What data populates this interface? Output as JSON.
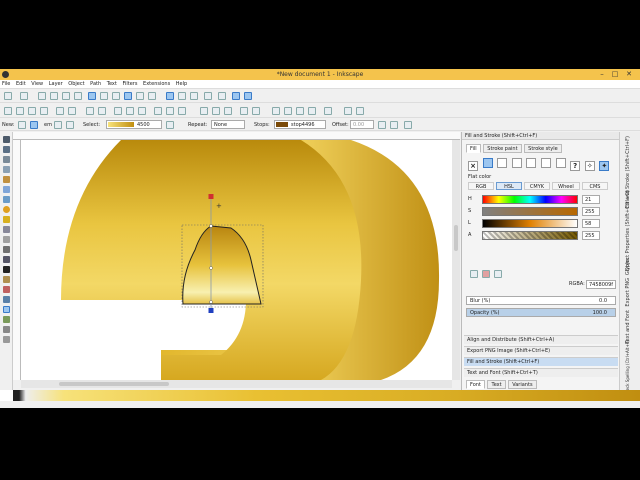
{
  "window": {
    "title": "*New document 1 - Inkscape",
    "min_label": "–",
    "max_label": "□",
    "close_label": "✕"
  },
  "menu": [
    "File",
    "Edit",
    "View",
    "Layer",
    "Object",
    "Path",
    "Text",
    "Filters",
    "Extensions",
    "Help"
  ],
  "gradient_toolbar": {
    "new_label": "New:",
    "units": "em",
    "select_label": "Select:",
    "select_value": "4500",
    "repeat_label": "Repeat:",
    "repeat_value": "None",
    "stops_label": "Stops:",
    "stop_value": "stop4496",
    "offset_label": "Offset:",
    "offset_value": "0.00"
  },
  "dock": {
    "header": "Fill and Stroke (Shift+Ctrl+F)",
    "tabs": [
      "Fill",
      "Stroke paint",
      "Stroke style"
    ],
    "paint_icons": [
      "×",
      "?",
      "✧",
      "✦"
    ],
    "flat_label": "Flat color",
    "modes": [
      "RGB",
      "HSL",
      "CMYK",
      "Wheel",
      "CMS"
    ],
    "sliders": [
      {
        "label": "H",
        "value": "21"
      },
      {
        "label": "S",
        "value": "255"
      },
      {
        "label": "L",
        "value": "58"
      },
      {
        "label": "A",
        "value": "255"
      }
    ],
    "rgba_label": "RGBA:",
    "rgba_value": "7458009f",
    "blur_label": "Blur (%)",
    "blur_value": "0.0",
    "opacity_label": "Opacity (%)",
    "opacity_value": "100.0",
    "panels": [
      "Align and Distribute (Shift+Ctrl+A)",
      "Export PNG Image (Shift+Ctrl+E)",
      "Fill and Stroke (Shift+Ctrl+F)",
      "Text and Font (Shift+Ctrl+T)"
    ],
    "text_tabs": [
      "Font",
      "Text",
      "Variants"
    ]
  },
  "side_tabs": [
    "Fill and Stroke (Shift+Ctrl+F)",
    "Object Properties (Shift+Ctrl+O)",
    "Glyphs",
    "Export PNG",
    "Text and Font",
    "Check Spelling (Ctrl+Alt+K)"
  ],
  "colors": {
    "accent": "#3a7bc8",
    "gold_light": "#f7e27a",
    "gold_mid": "#e2b72d",
    "gold_dark": "#b98a0c",
    "titlebar": "#f4c34c"
  }
}
